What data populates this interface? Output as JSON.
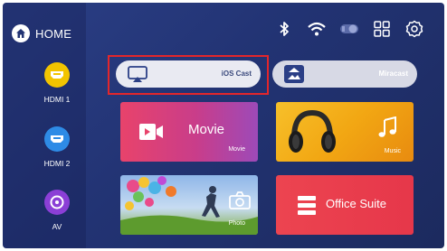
{
  "sidebar": {
    "home_label": "HOME",
    "sources": [
      {
        "label": "HDMI 1",
        "icon": "hdmi-icon",
        "color": "#f2c400"
      },
      {
        "label": "HDMI 2",
        "icon": "hdmi-icon",
        "color": "#2e8be6"
      },
      {
        "label": "AV",
        "icon": "av-disc-icon",
        "color": "#8b3fd6"
      }
    ]
  },
  "status_icons": [
    "bluetooth-icon",
    "wifi-icon",
    "toggle-icon",
    "apps-grid-icon",
    "settings-icon"
  ],
  "cast_bar": {
    "ios_cast_label": "iOS Cast",
    "miracast_label": "Miracast"
  },
  "tiles": {
    "movie": {
      "title": "Movie",
      "subtitle": "Movie",
      "color": "#e8436b"
    },
    "music": {
      "subtitle": "Music",
      "color": "#f2a713"
    },
    "photo": {
      "subtitle": "Photo"
    },
    "office": {
      "title": "Office Suite",
      "color": "#ea3b4b"
    }
  },
  "highlight_color": "#e3262b"
}
